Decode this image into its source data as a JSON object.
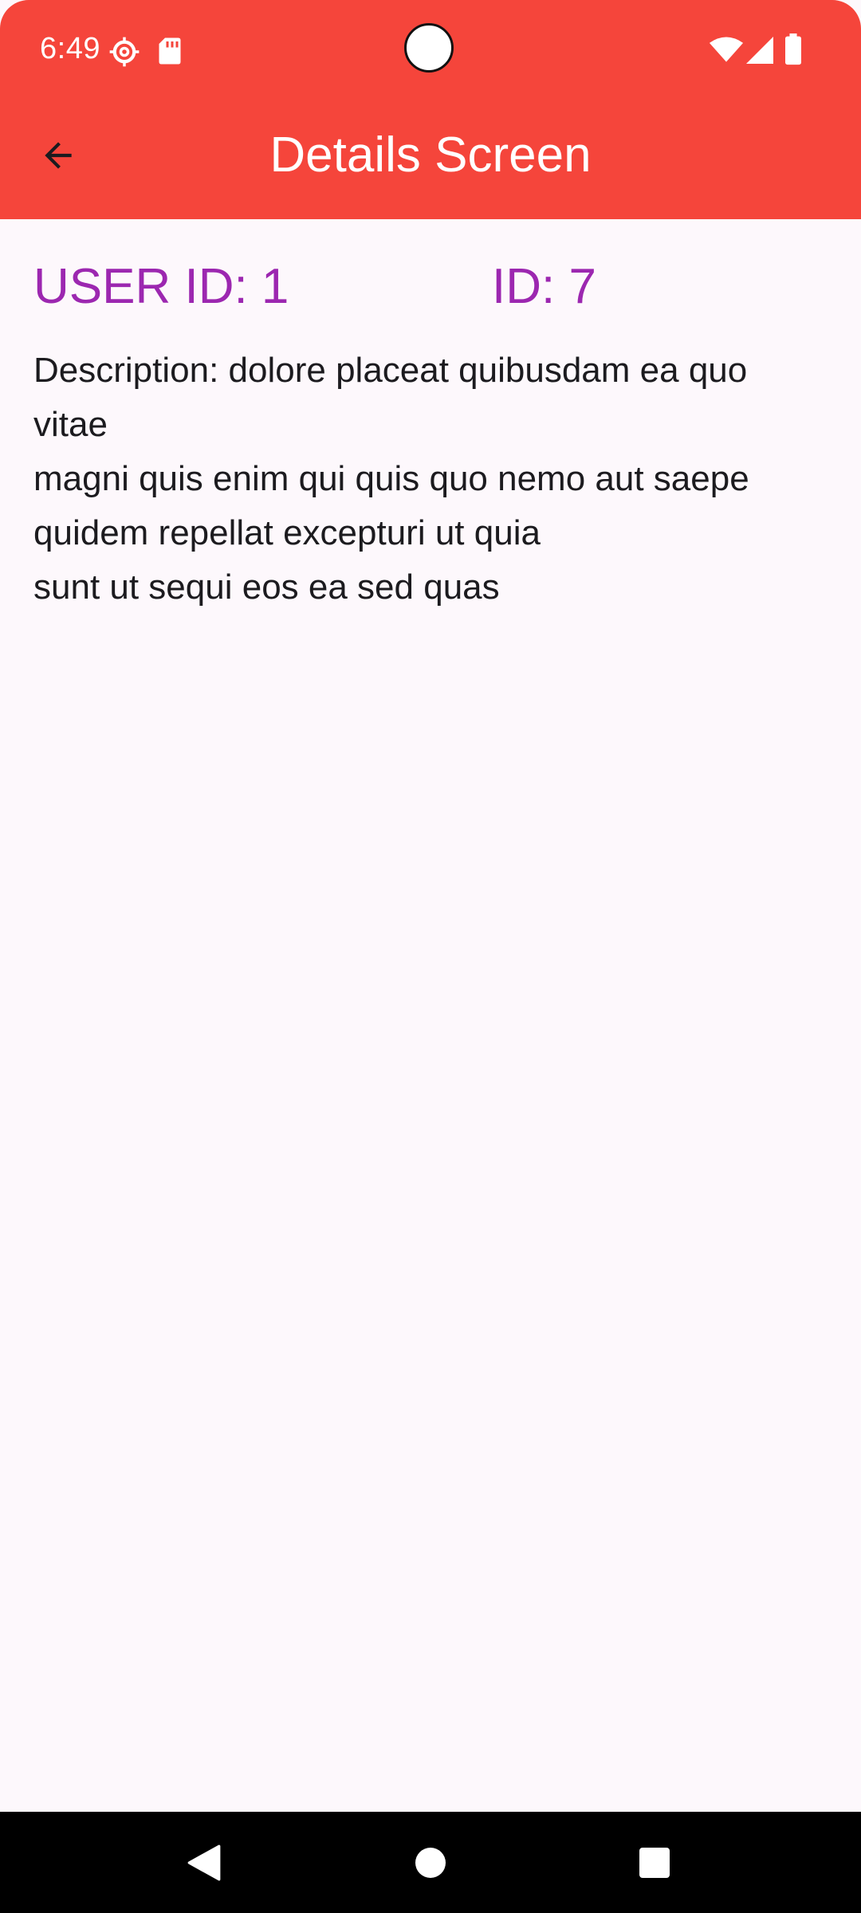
{
  "status_bar": {
    "time": "6:49",
    "icons": [
      "settings-gear-icon",
      "sd-card-icon",
      "wifi-icon",
      "cellular-signal-icon",
      "battery-icon"
    ]
  },
  "app_bar": {
    "title": "Details Screen",
    "back_icon": "arrow-back-icon",
    "background_color": "#f5453b"
  },
  "details": {
    "user_id_label": "USER ID: 1",
    "id_label": "ID: 7",
    "accent_color": "#9c27b0",
    "description_lines": [
      "Description: dolore placeat quibusdam ea quo",
      "vitae",
      "magni quis enim qui quis quo nemo aut saepe",
      "quidem repellat excepturi ut quia",
      "sunt ut sequi eos ea sed quas"
    ]
  },
  "nav_bar": {
    "buttons": [
      "back-triangle-icon",
      "home-circle-icon",
      "recents-square-icon"
    ]
  }
}
